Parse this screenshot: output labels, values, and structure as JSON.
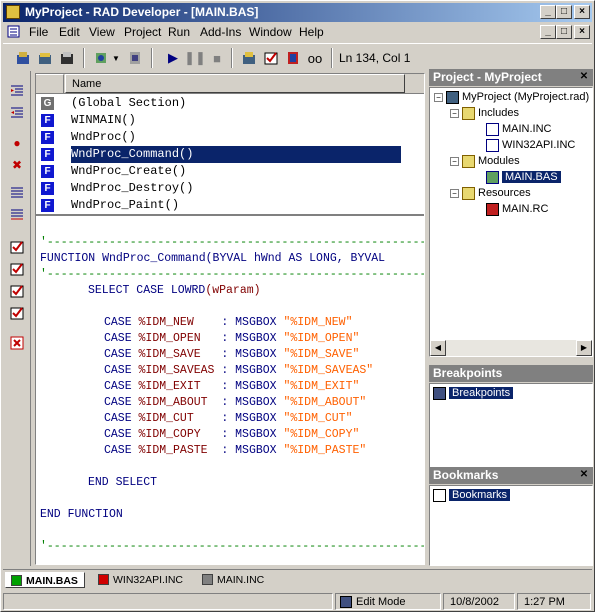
{
  "window": {
    "title": "MyProject - RAD Developer - [MAIN.BAS]",
    "controls": [
      "_",
      "□",
      "×"
    ]
  },
  "menubar": {
    "items": [
      "File",
      "Edit",
      "View",
      "Project",
      "Run",
      "Add-Ins",
      "Window",
      "Help"
    ],
    "mdi_controls": [
      "_",
      "□",
      "×"
    ]
  },
  "toolbar": {
    "position_text": "Ln 134, Col 1"
  },
  "procedures": {
    "header": "Name",
    "items": [
      {
        "badge": "G",
        "name": "(Global Section)"
      },
      {
        "badge": "F",
        "name": "WINMAIN()"
      },
      {
        "badge": "F",
        "name": "WndProc()"
      },
      {
        "badge": "F",
        "name": "WndProc_Command()"
      },
      {
        "badge": "F",
        "name": "WndProc_Create()"
      },
      {
        "badge": "F",
        "name": "WndProc_Destroy()"
      },
      {
        "badge": "F",
        "name": "WndProc_Paint()"
      }
    ],
    "selected_index": 3
  },
  "editor": {
    "separator": "'-----------------------------------------------------------",
    "function_line": {
      "kw": "FUNCTION",
      "rest": " WndProc_Command(BYVAL hWnd AS LONG, BYVAL"
    },
    "select_line": {
      "kw": "SELECT CASE LOWRD",
      "rest": "(wParam)"
    },
    "cases": [
      {
        "const": "%IDM_NEW    ",
        "str": "\"%IDM_NEW\""
      },
      {
        "const": "%IDM_OPEN   ",
        "str": "\"%IDM_OPEN\""
      },
      {
        "const": "%IDM_SAVE   ",
        "str": "\"%IDM_SAVE\""
      },
      {
        "const": "%IDM_SAVEAS ",
        "str": "\"%IDM_SAVEAS\""
      },
      {
        "const": "%IDM_EXIT   ",
        "str": "\"%IDM_EXIT\""
      },
      {
        "const": "%IDM_ABOUT  ",
        "str": "\"%IDM_ABOUT\""
      },
      {
        "const": "%IDM_CUT    ",
        "str": "\"%IDM_CUT\""
      },
      {
        "const": "%IDM_COPY   ",
        "str": "\"%IDM_COPY\""
      },
      {
        "const": "%IDM_PASTE  ",
        "str": "\"%IDM_PASTE\""
      }
    ],
    "case_kw": "CASE ",
    "msgbox_kw": ": MSGBOX ",
    "end_select": "END SELECT",
    "end_function": "END FUNCTION"
  },
  "project_panel": {
    "title": "Project - MyProject",
    "root": "MyProject (MyProject.rad)",
    "includes_label": "Includes",
    "includes": [
      "MAIN.INC",
      "WIN32API.INC"
    ],
    "modules_label": "Modules",
    "modules": [
      "MAIN.BAS"
    ],
    "resources_label": "Resources",
    "resources": [
      "MAIN.RC"
    ]
  },
  "breakpoints_panel": {
    "title": "Breakpoints",
    "item": "Breakpoints"
  },
  "bookmarks_panel": {
    "title": "Bookmarks",
    "item": "Bookmarks"
  },
  "file_tabs": [
    {
      "label": "MAIN.BAS",
      "color": "#00a000"
    },
    {
      "label": "WIN32API.INC",
      "color": "#d00000"
    },
    {
      "label": "MAIN.INC",
      "color": "#808080"
    }
  ],
  "statusbar": {
    "mode": "Edit Mode",
    "date": "10/8/2002",
    "time": "1:27 PM"
  },
  "colors": {
    "title_active": "#0a246a",
    "keyword": "#000080",
    "comment": "#008000",
    "string": "#ff6000",
    "constant": "#800000"
  }
}
